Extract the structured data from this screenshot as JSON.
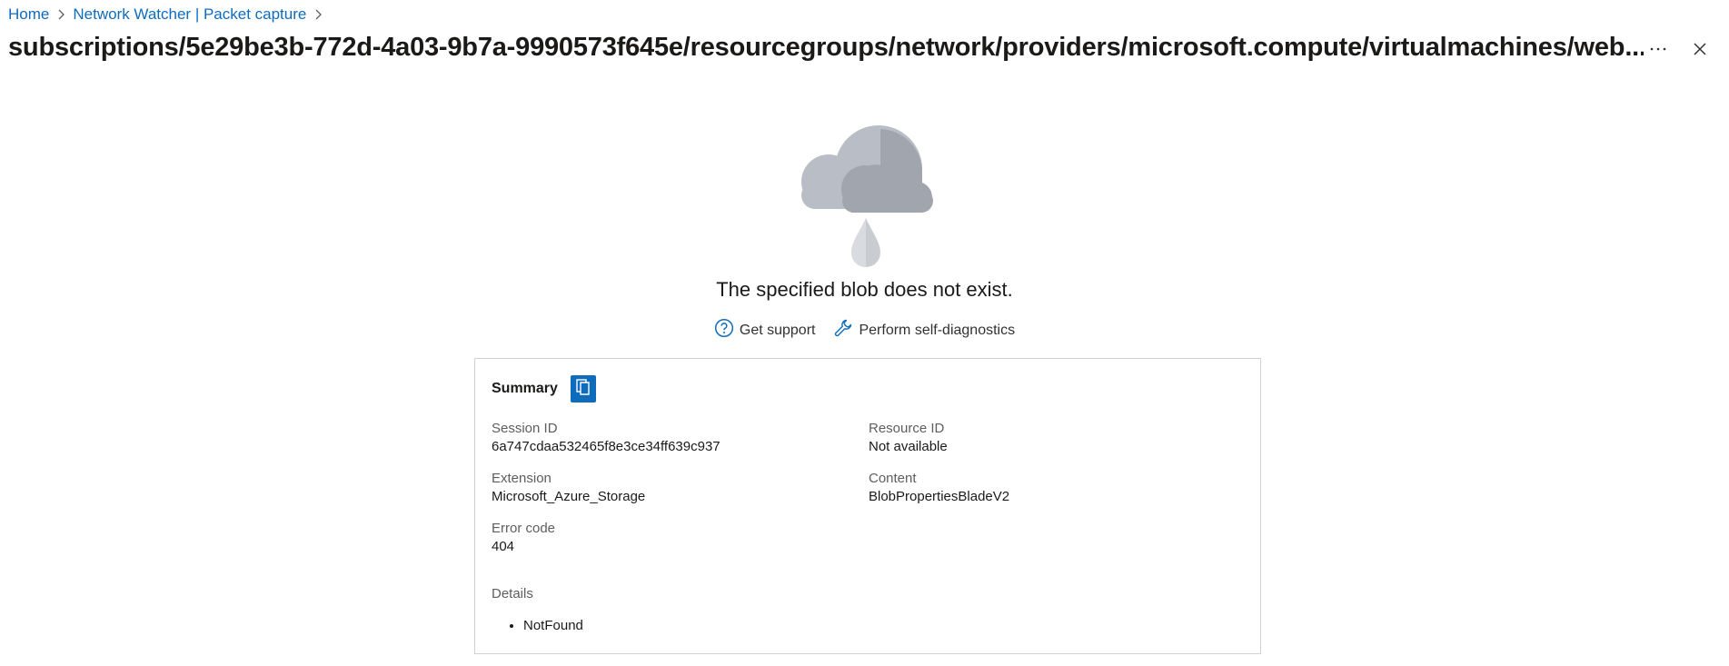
{
  "breadcrumb": {
    "items": [
      {
        "label": "Home"
      },
      {
        "label": "Network Watcher | Packet capture"
      }
    ]
  },
  "header": {
    "title": "subscriptions/5e29be3b-772d-4a03-9b7a-9990573f645e/resourcegroups/network/providers/microsoft.compute/virtualmachines/web...",
    "more_label": "···"
  },
  "error": {
    "message": "The specified blob does not exist.",
    "get_support_label": "Get support",
    "self_diagnostics_label": "Perform self-diagnostics"
  },
  "summary": {
    "title": "Summary",
    "session_id_label": "Session ID",
    "session_id_value": "6a747cdaa532465f8e3ce34ff639c937",
    "resource_id_label": "Resource ID",
    "resource_id_value": "Not available",
    "extension_label": "Extension",
    "extension_value": "Microsoft_Azure_Storage",
    "content_label": "Content",
    "content_value": "BlobPropertiesBladeV2",
    "error_code_label": "Error code",
    "error_code_value": "404",
    "details_label": "Details",
    "details_items": [
      "NotFound"
    ]
  },
  "icons": {
    "breadcrumb_separator": "chevron-right-icon",
    "more": "more-icon",
    "close": "close-icon",
    "cloud": "rain-cloud-icon",
    "support": "help-circle-icon",
    "diagnostics": "wrench-icon",
    "copy": "copy-icon"
  },
  "colors": {
    "accent": "#0f6cbd",
    "cloud_light": "#b9bec6",
    "cloud_dark": "#a0a5ae",
    "drop": "#c9cdd2"
  }
}
